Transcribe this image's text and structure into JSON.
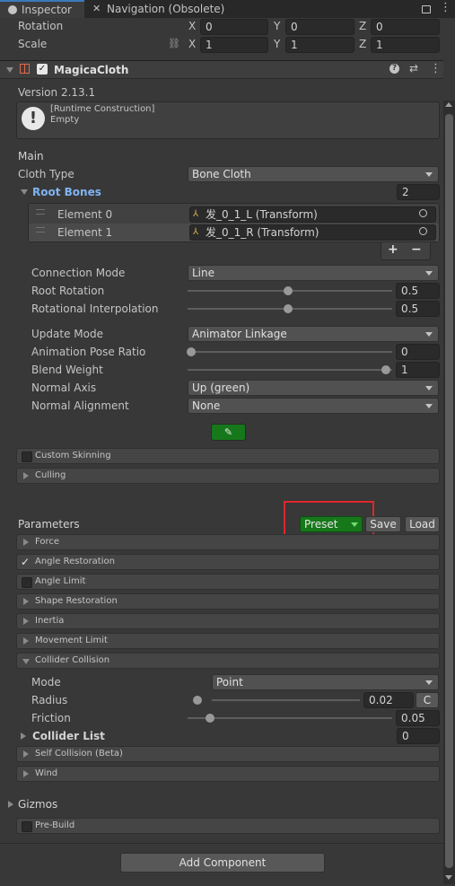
{
  "tabs": {
    "inspector": "Inspector",
    "navigation": "Navigation (Obsolete)"
  },
  "transform": {
    "rotation_label": "Rotation",
    "scale_label": "Scale",
    "rotation": {
      "x": "0",
      "y": "0",
      "z": "0"
    },
    "scale": {
      "x": "1",
      "y": "1",
      "z": "1"
    },
    "axes": {
      "x": "X",
      "y": "Y",
      "z": "Z"
    }
  },
  "component": {
    "name": "MagicaCloth",
    "version": "Version 2.13.1",
    "info_line1": "[Runtime Construction]",
    "info_line2": "Empty"
  },
  "main": {
    "heading": "Main",
    "cloth_type_label": "Cloth Type",
    "cloth_type": "Bone Cloth",
    "root_bones_label": "Root Bones",
    "root_bones_count": "2",
    "elements": [
      {
        "label": "Element 0",
        "value": "发_0_1_L (Transform)"
      },
      {
        "label": "Element 1",
        "value": "发_0_1_R (Transform)"
      }
    ],
    "plus": "+",
    "minus": "−",
    "connection_mode_label": "Connection Mode",
    "connection_mode": "Line",
    "root_rotation_label": "Root Rotation",
    "root_rotation": "0.5",
    "rotational_interpolation_label": "Rotational Interpolation",
    "rotational_interpolation": "0.5",
    "update_mode_label": "Update Mode",
    "update_mode": "Animator Linkage",
    "animation_pose_ratio_label": "Animation Pose Ratio",
    "animation_pose_ratio": "0",
    "blend_weight_label": "Blend Weight",
    "blend_weight": "1",
    "normal_axis_label": "Normal Axis",
    "normal_axis": "Up (green)",
    "normal_alignment_label": "Normal Alignment",
    "normal_alignment": "None",
    "custom_skinning": "Custom Skinning",
    "culling": "Culling"
  },
  "parameters": {
    "heading": "Parameters",
    "preset": "Preset",
    "save": "Save",
    "load": "Load",
    "foldouts": {
      "force": "Force",
      "angle_restoration": "Angle Restoration",
      "angle_limit": "Angle Limit",
      "shape_restoration": "Shape Restoration",
      "inertia": "Inertia",
      "movement_limit": "Movement Limit",
      "collider_collision": "Collider Collision",
      "self_collision": "Self Collision (Beta)",
      "wind": "Wind"
    },
    "mode_label": "Mode",
    "mode": "Point",
    "radius_label": "Radius",
    "radius": "0.02",
    "radius_button": "C",
    "friction_label": "Friction",
    "friction": "0.05",
    "collider_list_label": "Collider List",
    "collider_list_count": "0"
  },
  "gizmos": {
    "heading": "Gizmos",
    "pre_build": "Pre-Build"
  },
  "add_component": "Add Component",
  "colors": {
    "accent_blue": "#3a79bb",
    "preset_green": "#16781a",
    "highlight_red": "#e0262b",
    "link_blue": "#7fb4f2"
  }
}
